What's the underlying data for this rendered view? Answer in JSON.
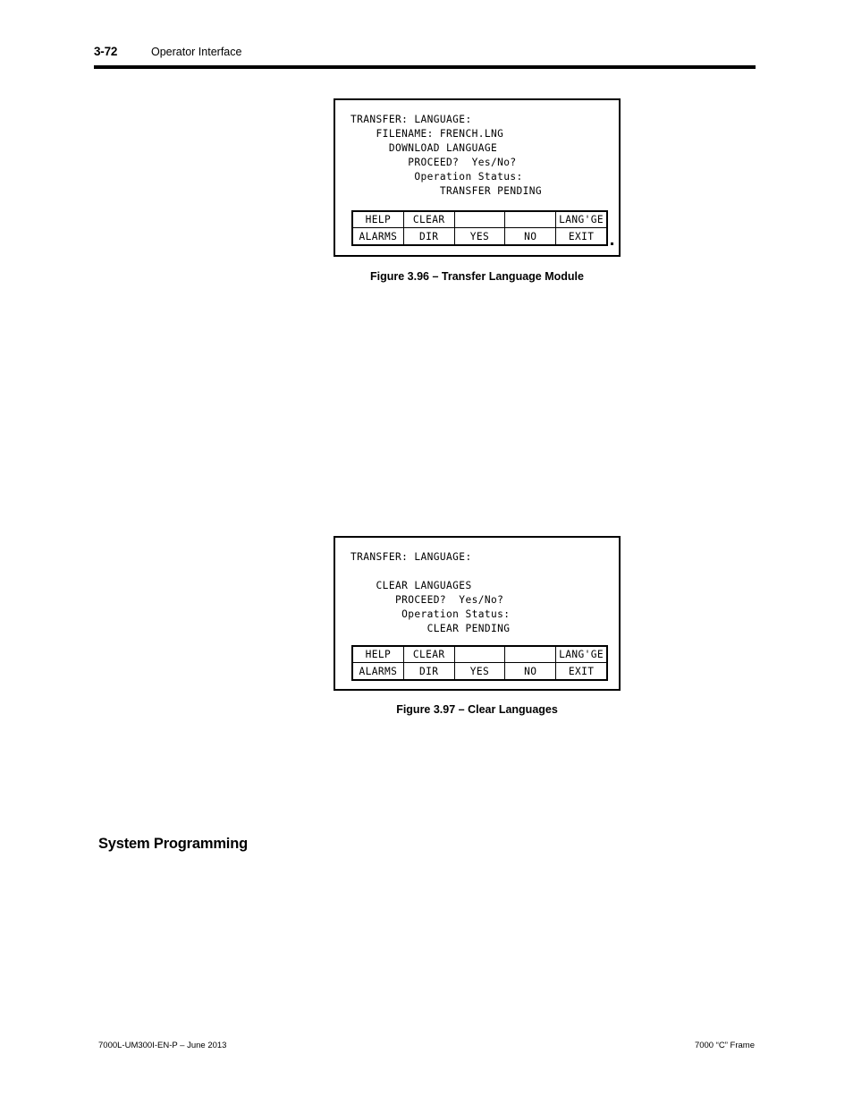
{
  "header": {
    "page_number": "3-72",
    "title": "Operator Interface"
  },
  "figures": [
    {
      "id": "figure-3-96",
      "caption": "Figure 3.96 – Transfer Language Module",
      "screen_lines": [
        {
          "text": "TRANSFER: LANGUAGE:",
          "indent": 0
        },
        {
          "text": "FILENAME: FRENCH.LNG",
          "indent": 4
        },
        {
          "text": "DOWNLOAD LANGUAGE",
          "indent": 6
        },
        {
          "text": "PROCEED?  Yes/No?",
          "indent": 9
        },
        {
          "text": "Operation Status:",
          "indent": 10
        },
        {
          "text": "TRANSFER PENDING",
          "indent": 14
        }
      ],
      "softkeys": {
        "top_row": [
          "HELP",
          "CLEAR",
          "",
          "",
          "LANG'GE"
        ],
        "bottom_row": [
          "ALARMS",
          "DIR",
          "YES",
          "NO",
          "EXIT"
        ]
      },
      "has_trailing_dot": true
    },
    {
      "id": "figure-3-97",
      "caption": "Figure 3.97 – Clear Languages",
      "screen_lines": [
        {
          "text": "TRANSFER: LANGUAGE:",
          "indent": 0
        },
        {
          "text": "",
          "indent": 0
        },
        {
          "text": "CLEAR LANGUAGES",
          "indent": 4
        },
        {
          "text": "PROCEED?  Yes/No?",
          "indent": 7
        },
        {
          "text": "Operation Status:",
          "indent": 8
        },
        {
          "text": "CLEAR PENDING",
          "indent": 12
        }
      ],
      "softkeys": {
        "top_row": [
          "HELP",
          "CLEAR",
          "",
          "",
          "LANG'GE"
        ],
        "bottom_row": [
          "ALARMS",
          "DIR",
          "YES",
          "NO",
          "EXIT"
        ]
      },
      "has_trailing_dot": false
    }
  ],
  "section": {
    "heading": "System Programming"
  },
  "footer": {
    "left": "7000L-UM300I-EN-P – June 2013",
    "right": "7000 “C” Frame"
  }
}
